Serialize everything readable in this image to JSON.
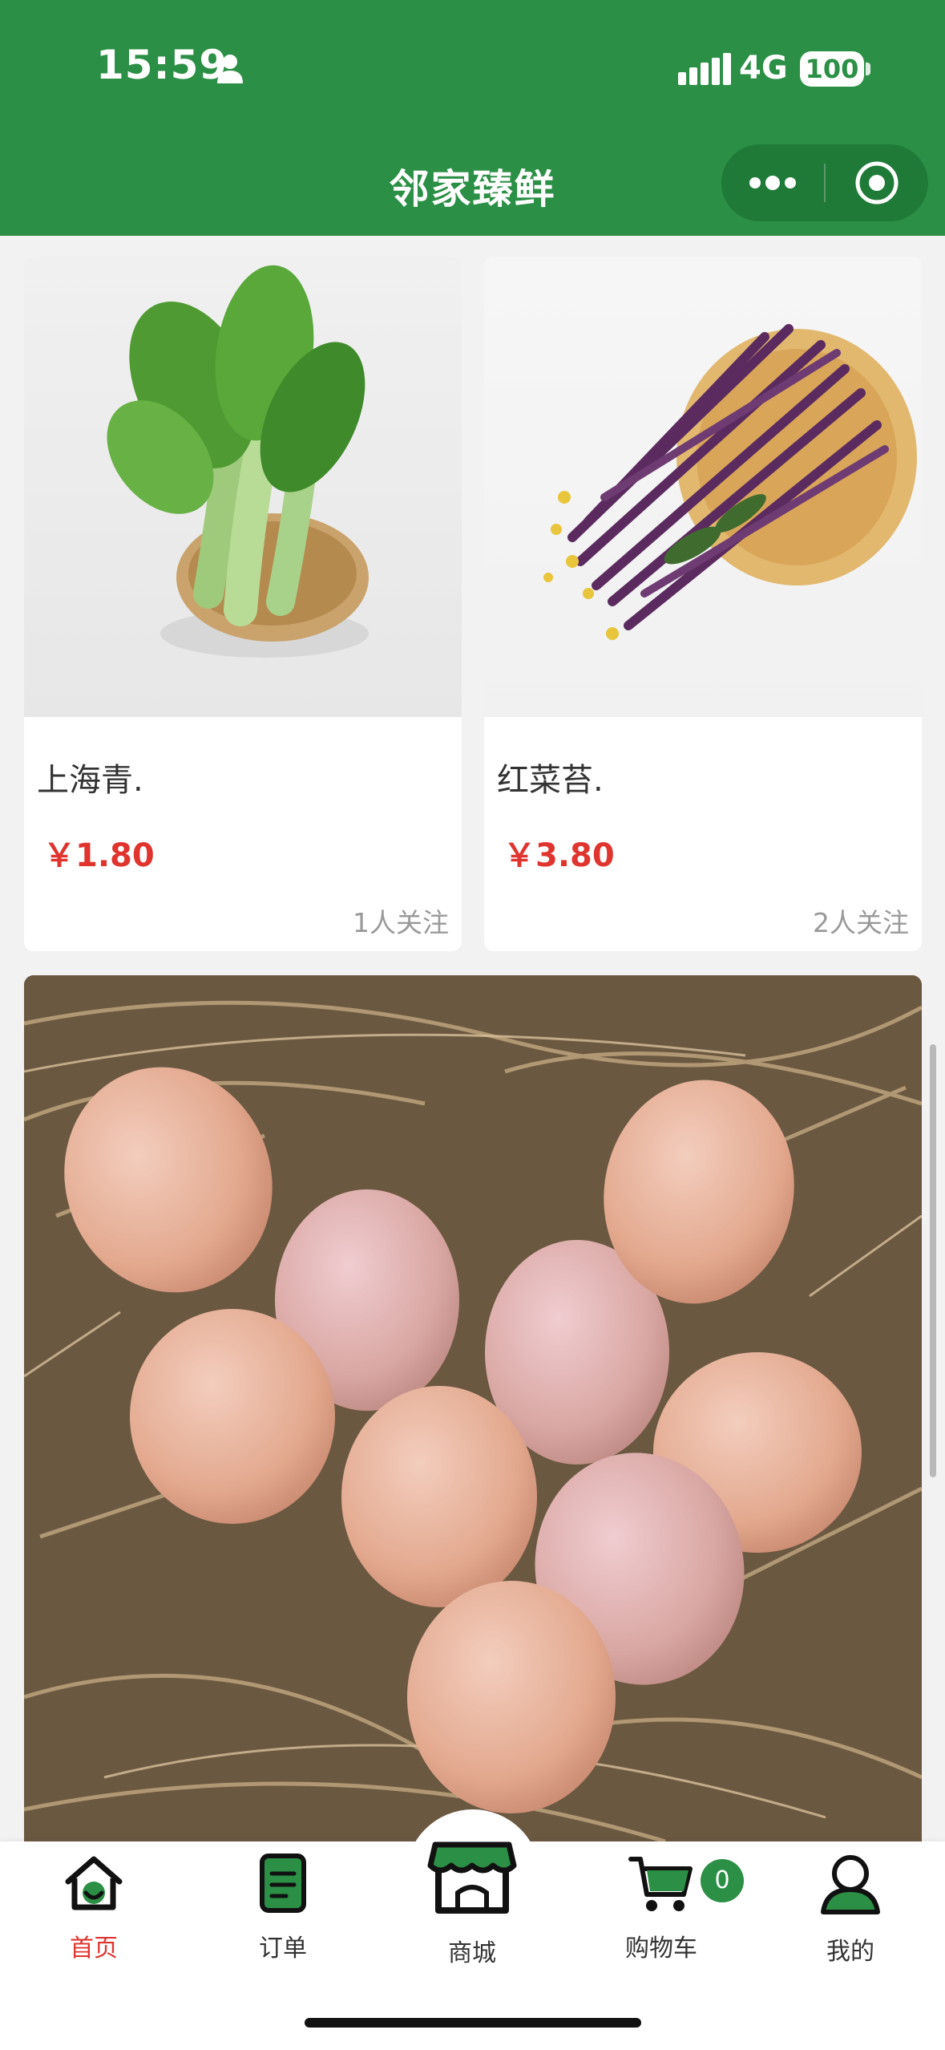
{
  "status_bar": {
    "time": "15:59",
    "network": "4G",
    "battery": "100",
    "icons": [
      "person-icon",
      "signal-icon",
      "battery-icon"
    ]
  },
  "header": {
    "title": "邻家臻鲜",
    "capsule_icons": [
      "more-icon",
      "target-icon"
    ]
  },
  "products": [
    {
      "name": "上海青.",
      "price": "￥1.80",
      "followers": "1人关注",
      "image": "bok-choy-image"
    },
    {
      "name": "红菜苔.",
      "price": "￥3.80",
      "followers": "2人关注",
      "image": "purple-choy-sum-image"
    }
  ],
  "banner": {
    "image": "eggs-in-straw-nest-image"
  },
  "tabbar": {
    "items": [
      {
        "label": "首页",
        "icon": "home-icon",
        "active": true
      },
      {
        "label": "订单",
        "icon": "order-icon",
        "active": false
      },
      {
        "label": "商城",
        "icon": "store-icon",
        "active": false
      },
      {
        "label": "购物车",
        "icon": "cart-icon",
        "active": false
      },
      {
        "label": "我的",
        "icon": "user-icon",
        "active": false
      }
    ],
    "cart_count": "0"
  },
  "colors": {
    "brand_green": "#2b8f45",
    "price_red": "#e0342f",
    "active_tab": "#e0342f"
  }
}
